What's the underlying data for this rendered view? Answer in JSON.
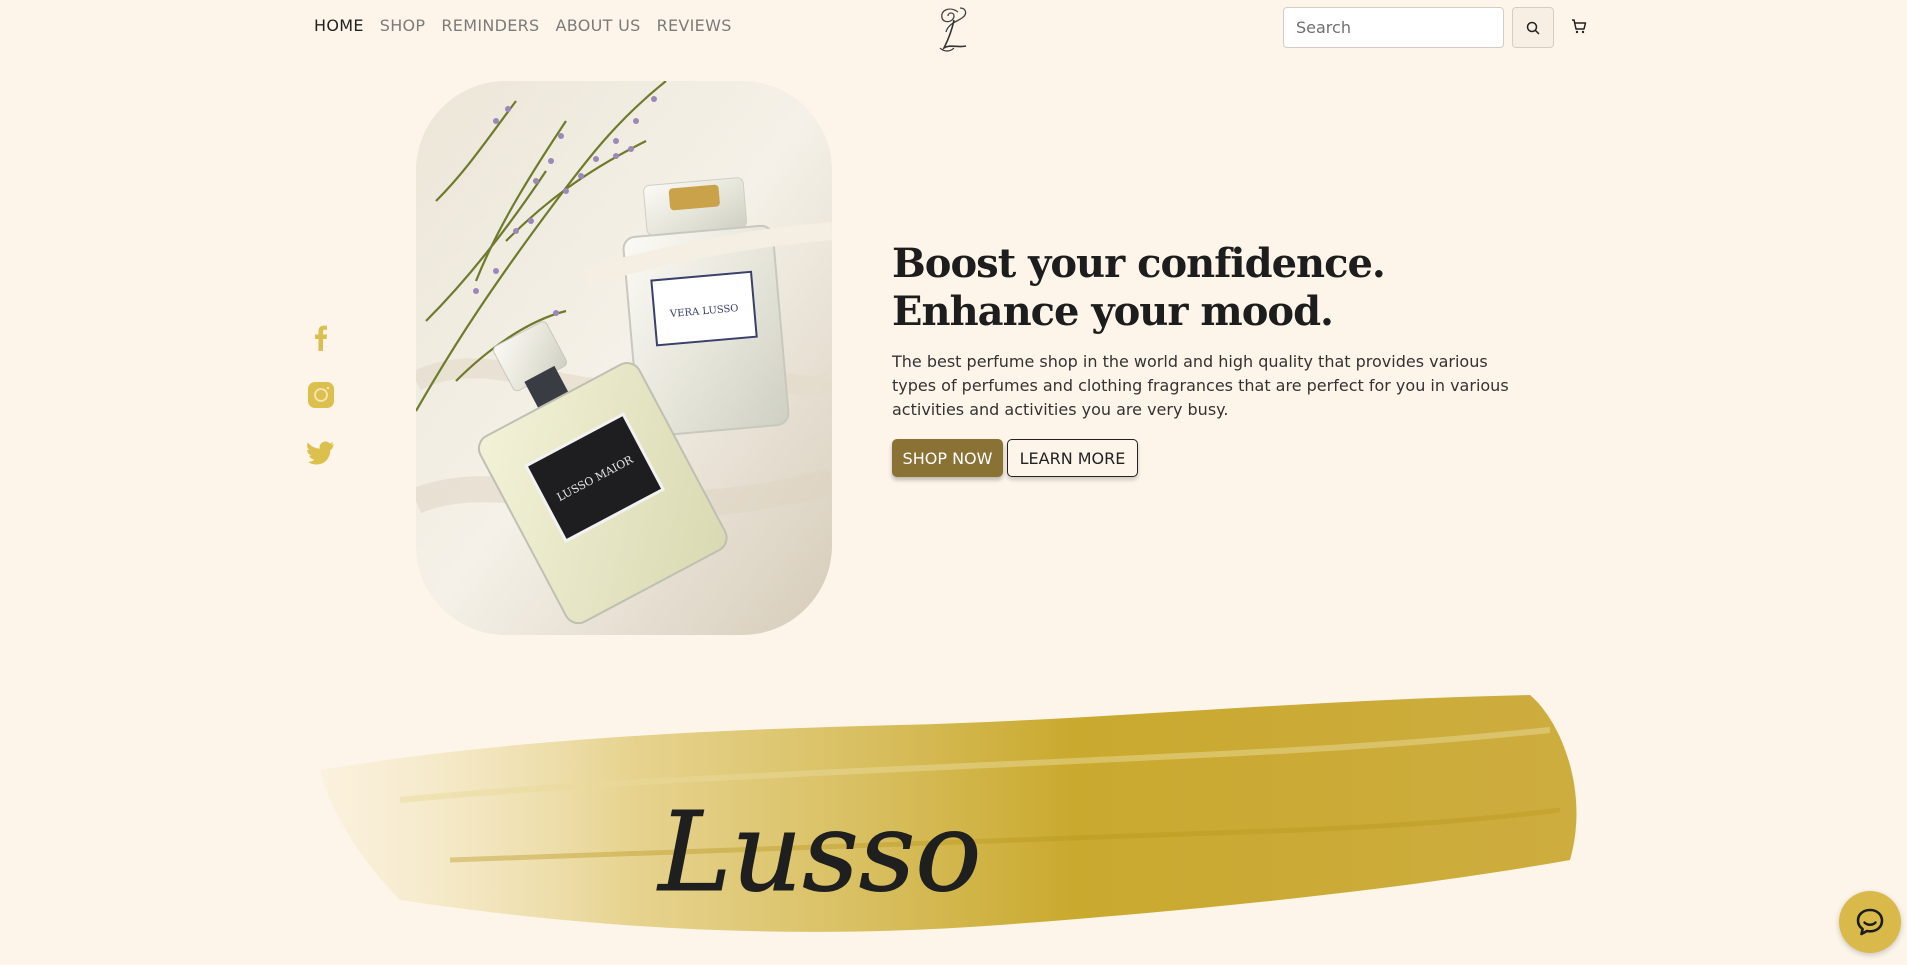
{
  "nav": {
    "items": [
      {
        "label": "HOME",
        "active": true
      },
      {
        "label": "SHOP"
      },
      {
        "label": "REMINDERS"
      },
      {
        "label": "ABOUT US"
      },
      {
        "label": "REVIEWS"
      }
    ]
  },
  "header": {
    "logo_icon": "monogram-logo-icon",
    "search_placeholder": "Search",
    "search_icon": "search-icon",
    "cart_icon": "cart-icon"
  },
  "social": [
    {
      "icon": "facebook-icon"
    },
    {
      "icon": "instagram-icon"
    },
    {
      "icon": "twitter-icon"
    }
  ],
  "hero": {
    "headline_line1": "Boost your confidence.",
    "headline_line2": "Enhance your mood.",
    "description": "The best perfume shop in the world and high quality that provides various types of perfumes and clothing fragrances that are perfect for you in various activities and activities you are very busy.",
    "shop_label": "SHOP NOW",
    "learn_label": "LEARN MORE",
    "bottle_front_label": "LUSSO MAIOR",
    "bottle_back_label": "VERA LUSSO",
    "ribbon_text": "LUSSO MAIOR"
  },
  "banner": {
    "script_text": "Lusso"
  },
  "colors": {
    "background": "#fdf5ea",
    "accent": "#8a7234",
    "gold": "#d9b94a",
    "social": "#dcc04e"
  },
  "chat": {
    "icon": "chat-icon"
  }
}
